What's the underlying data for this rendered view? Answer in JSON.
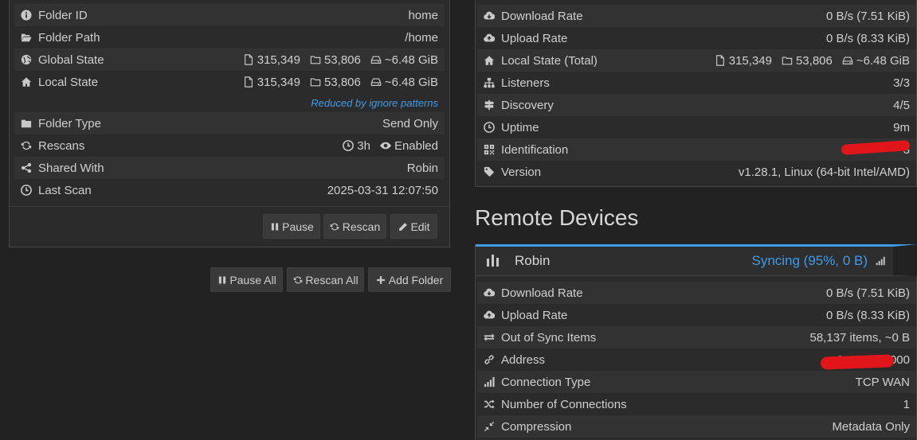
{
  "folder": {
    "rows": [
      {
        "icon": "info-icon",
        "label": "Folder ID",
        "value": "home"
      },
      {
        "icon": "folder-open-icon",
        "label": "Folder Path",
        "value": "/home"
      }
    ],
    "global_state": {
      "label": "Global State",
      "files": "315,349",
      "dirs": "53,806",
      "size": "~6.48 GiB"
    },
    "local_state": {
      "label": "Local State",
      "files": "315,349",
      "dirs": "53,806",
      "size": "~6.48 GiB"
    },
    "ignore_note": "Reduced by ignore patterns",
    "folder_type": {
      "label": "Folder Type",
      "value": "Send Only"
    },
    "rescans": {
      "label": "Rescans",
      "interval": "3h",
      "watcher": "Enabled"
    },
    "shared_with": {
      "label": "Shared With",
      "value": "Robin"
    },
    "last_scan": {
      "label": "Last Scan",
      "value": "2025-03-31 12:07:50"
    },
    "buttons": {
      "pause": "Pause",
      "rescan": "Rescan",
      "edit": "Edit"
    }
  },
  "global_buttons": {
    "pause_all": "Pause All",
    "rescan_all": "Rescan All",
    "add_folder": "Add Folder"
  },
  "this_device": {
    "download_rate": {
      "label": "Download Rate",
      "value": "0 B/s (7.51 KiB)"
    },
    "upload_rate": {
      "label": "Upload Rate",
      "value": "0 B/s (8.33 KiB)"
    },
    "local_state_total": {
      "label": "Local State (Total)",
      "files": "315,349",
      "dirs": "53,806",
      "size": "~6.48 GiB"
    },
    "listeners": {
      "label": "Listeners",
      "value": "3/3"
    },
    "discovery": {
      "label": "Discovery",
      "value": "4/5"
    },
    "uptime": {
      "label": "Uptime",
      "value": "9m"
    },
    "identification": {
      "label": "Identification",
      "value": "3"
    },
    "version": {
      "label": "Version",
      "value": "v1.28.1, Linux (64-bit Intel/AMD)"
    }
  },
  "remote_devices": {
    "heading": "Remote Devices",
    "device": {
      "name": "Robin",
      "status": "Syncing (95%, 0 B)",
      "download_rate": {
        "label": "Download Rate",
        "value": "0 B/s (7.51 KiB)"
      },
      "upload_rate": {
        "label": "Upload Rate",
        "value": "0 B/s (8.33 KiB)"
      },
      "out_of_sync": {
        "label": "Out of Sync Items",
        "value": "58,137 items, ~0 B"
      },
      "address": {
        "label": "Address",
        "value": "1          22000"
      },
      "connection_type": {
        "label": "Connection Type",
        "value": "TCP WAN"
      },
      "num_connections": {
        "label": "Number of Connections",
        "value": "1"
      },
      "compression": {
        "label": "Compression",
        "value": "Metadata Only"
      }
    }
  },
  "colors": {
    "accent": "#3f9be6",
    "success": "#3fb950",
    "redaction": "#e0161a"
  }
}
